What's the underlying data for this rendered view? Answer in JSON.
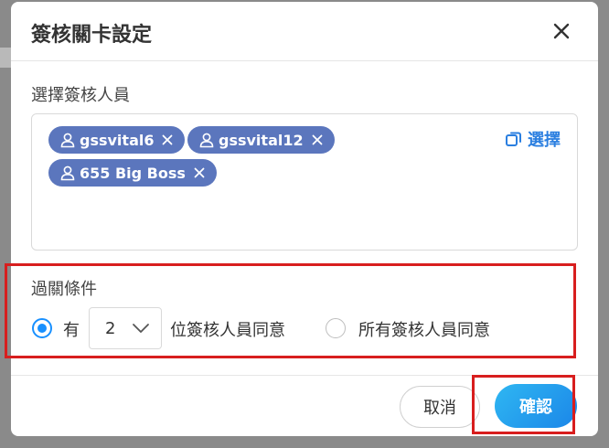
{
  "dialog": {
    "title": "簽核關卡設定",
    "close_icon": "close-icon"
  },
  "approvers": {
    "label": "選擇簽核人員",
    "tags": [
      {
        "name": "gssvital6"
      },
      {
        "name": "gssvital12"
      },
      {
        "name": "655 Big Boss"
      }
    ],
    "select_label": "選擇",
    "select_icon": "copy-icon"
  },
  "condition": {
    "label": "過關條件",
    "option_some_prefix": "有",
    "count_value": "2",
    "option_some_suffix": "位簽核人員同意",
    "option_all_label": "所有簽核人員同意",
    "selected": "some"
  },
  "footer": {
    "cancel_label": "取消",
    "confirm_label": "確認"
  },
  "colors": {
    "tag_bg": "#5b76bd",
    "accent": "#1890ff",
    "highlight": "#d81e1e"
  }
}
